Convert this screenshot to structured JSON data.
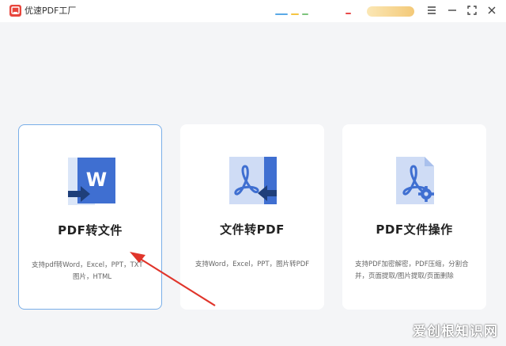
{
  "app": {
    "title": "优速PDF工厂"
  },
  "colors": {
    "accent": "#4a7ed6",
    "selected_border": "#79aee8",
    "arrow": "#e0352b",
    "logo": "#e8453c"
  },
  "window_controls": [
    "menu-icon",
    "minimize-icon",
    "maximize-icon",
    "close-icon"
  ],
  "cards": [
    {
      "title": "PDF转文件",
      "desc_lines": [
        "支持pdf转Word，Excel，PPT，TXT",
        "图片，HTML"
      ],
      "icon": "pdf-to-word-icon"
    },
    {
      "title": "文件转PDF",
      "desc_lines": [
        "支持Word，Excel，PPT，图片转PDF"
      ],
      "icon": "file-to-pdf-icon"
    },
    {
      "title": "PDF文件操作",
      "desc_lines": [
        "支持PDF加密解密，PDF压缩，分割合",
        "并，页面提取/图片提取/页面删除"
      ],
      "icon": "pdf-settings-icon"
    }
  ],
  "watermark": "爱创根知识网"
}
